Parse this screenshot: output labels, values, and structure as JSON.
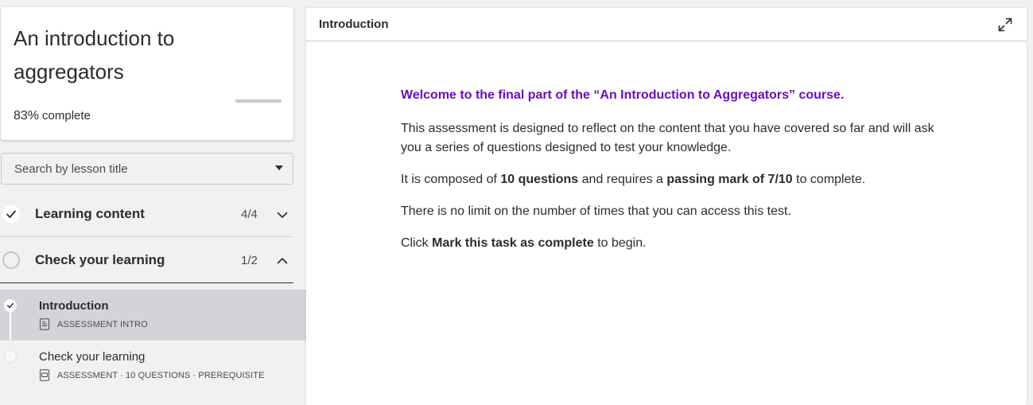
{
  "course": {
    "title": "An introduction to aggregators",
    "progress_percent": 83,
    "progress_label": "83%",
    "progress_suffix": "complete"
  },
  "search": {
    "placeholder": "Search by lesson title"
  },
  "sections": [
    {
      "label": "Learning content",
      "count": "4/4",
      "status": "complete",
      "expanded": false
    },
    {
      "label": "Check your learning",
      "count": "1/2",
      "status": "in-progress",
      "expanded": true
    }
  ],
  "lessons": [
    {
      "title": "Introduction",
      "meta": "ASSESSMENT INTRO",
      "status": "complete",
      "active": true
    },
    {
      "title": "Check your learning",
      "meta": "ASSESSMENT · 10 QUESTIONS · PREREQUISITE",
      "status": "not-started",
      "active": false
    }
  ],
  "main": {
    "header_title": "Introduction",
    "welcome": "Welcome to the final part of the “An Introduction to Aggregators” course.",
    "para1": "This assessment is designed to reflect on the content that you have covered so far and will ask you a series of questions designed to test your knowledge.",
    "para2_a": "It is composed of ",
    "para2_b": "10 questions",
    "para2_c": " and requires a ",
    "para2_d": "passing mark of 7/10",
    "para2_e": " to complete.",
    "para3": "There is no limit on the number of times that you can access this test.",
    "para4_a": "Click ",
    "para4_b": "Mark this task as complete",
    "para4_c": " to begin."
  },
  "colors": {
    "accent_purple": "#6a0dc0",
    "active_row": "#d4d4d8",
    "background": "#f1f1f2"
  },
  "icons": {
    "expand": "expand-icon",
    "check": "check-icon",
    "chevron_down": "chevron-down-icon",
    "chevron_up": "chevron-up-icon",
    "document": "document-icon"
  }
}
